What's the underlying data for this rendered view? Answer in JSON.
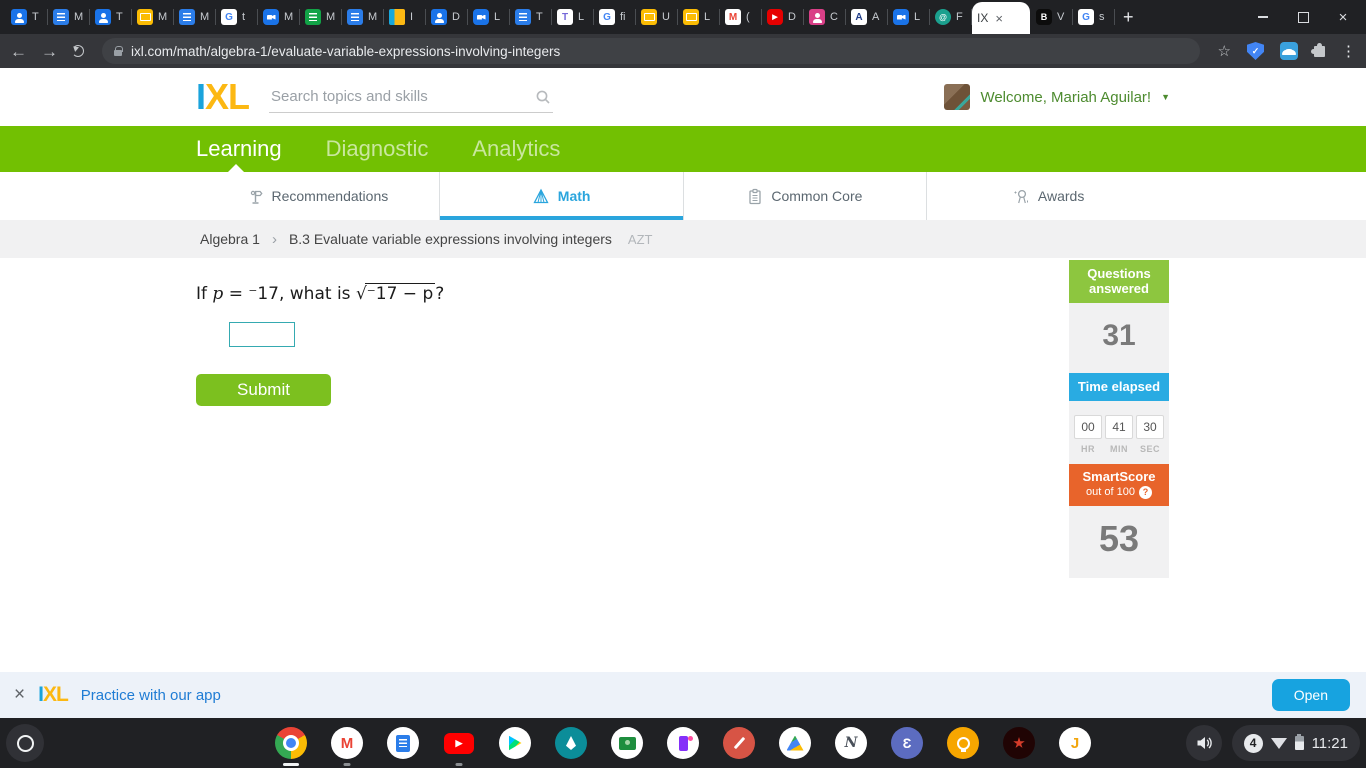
{
  "icons": {
    "back": "←",
    "forward": "→",
    "star": "☆",
    "kebab": "⋮",
    "new_tab": "+",
    "window_close": "×",
    "tab_close": "×",
    "banner_close": "×",
    "dropdown": "▼",
    "breadcrumb_sep": "›",
    "help": "?",
    "shield_check": "✓"
  },
  "browser": {
    "url": "ixl.com/math/algebra-1/evaluate-variable-expressions-involving-integers",
    "favicon_glyphs": {
      "google": "G",
      "gmail": "M",
      "youtube": "▶",
      "translate": "T",
      "acellus": "A",
      "prodigy": "@",
      "bitmoji": "B"
    },
    "tabs": [
      {
        "icon": "contacts",
        "label": "T"
      },
      {
        "icon": "docs",
        "label": "M"
      },
      {
        "icon": "contacts",
        "label": "T"
      },
      {
        "icon": "slides",
        "label": "M"
      },
      {
        "icon": "docs",
        "label": "M"
      },
      {
        "icon": "google",
        "label": "t"
      },
      {
        "icon": "meet",
        "label": "M"
      },
      {
        "icon": "sheets",
        "label": "M"
      },
      {
        "icon": "docs",
        "label": "M"
      },
      {
        "icon": "ixl",
        "label": "I"
      },
      {
        "icon": "contacts",
        "label": "D"
      },
      {
        "icon": "meet",
        "label": "L"
      },
      {
        "icon": "docs",
        "label": "T"
      },
      {
        "icon": "translate",
        "label": "L"
      },
      {
        "icon": "google",
        "label": "fi"
      },
      {
        "icon": "slides",
        "label": "U"
      },
      {
        "icon": "slides",
        "label": "L"
      },
      {
        "icon": "gmail",
        "label": "("
      },
      {
        "icon": "youtube",
        "label": "D"
      },
      {
        "icon": "contacts-pink",
        "label": "C"
      },
      {
        "icon": "acellus",
        "label": "A"
      },
      {
        "icon": "meet",
        "label": "L"
      },
      {
        "icon": "prodigy",
        "label": "F"
      },
      {
        "icon": "none",
        "label": "IX",
        "active": true
      },
      {
        "icon": "bitmoji",
        "label": "V"
      },
      {
        "icon": "google",
        "label": "s"
      }
    ]
  },
  "ixl": {
    "logo": {
      "i": "I",
      "xl": "XL"
    },
    "search_placeholder": "Search topics and skills",
    "welcome": "Welcome, Mariah Aguilar!",
    "nav": [
      {
        "label": "Learning",
        "active": true
      },
      {
        "label": "Diagnostic",
        "active": false
      },
      {
        "label": "Analytics",
        "active": false
      }
    ],
    "subnav": [
      {
        "label": "Recommendations",
        "active": false
      },
      {
        "label": "Math",
        "active": true
      },
      {
        "label": "Common Core",
        "active": false
      },
      {
        "label": "Awards",
        "active": false
      }
    ],
    "breadcrumb": {
      "category": "Algebra 1",
      "skill": "B.3 Evaluate variable expressions involving integers",
      "code": "AZT"
    },
    "question": {
      "part1": "If ",
      "variable": "p",
      "part2": " = ",
      "value": "⁻17",
      "part3": ", what is ",
      "radical": "√",
      "radicand": "⁻17 − p",
      "part4": "?",
      "answer_value": ""
    },
    "submit_label": "Submit",
    "stats": {
      "questions": {
        "title": "Questions answered",
        "value": "31"
      },
      "time": {
        "title": "Time elapsed",
        "hr": "00",
        "min": "41",
        "sec": "30",
        "hr_label": "HR",
        "min_label": "MIN",
        "sec_label": "SEC"
      },
      "smartscore": {
        "title": "SmartScore",
        "subtitle": "out of 100",
        "value": "53"
      }
    },
    "banner": {
      "logo_i": "I",
      "logo_xl": "XL",
      "text": "Practice with our app",
      "open_label": "Open"
    }
  },
  "shelf": {
    "apps": [
      {
        "name": "chrome",
        "indicator": "active"
      },
      {
        "name": "gmail",
        "indicator": "open"
      },
      {
        "name": "docs",
        "indicator": null
      },
      {
        "name": "youtube",
        "indicator": "open"
      },
      {
        "name": "play-store",
        "indicator": null
      },
      {
        "name": "painter",
        "indicator": null
      },
      {
        "name": "classroom",
        "indicator": null
      },
      {
        "name": "purple-app",
        "indicator": null
      },
      {
        "name": "sketch",
        "indicator": null
      },
      {
        "name": "drive",
        "indicator": null
      },
      {
        "name": "squid",
        "indicator": null
      },
      {
        "name": "edpuzzle",
        "indicator": null
      },
      {
        "name": "keep",
        "indicator": null
      },
      {
        "name": "game",
        "indicator": null
      },
      {
        "name": "music",
        "indicator": null
      }
    ],
    "tray": {
      "notifications": "4",
      "time": "11:21"
    }
  },
  "colors": {
    "ixl_green": "#72c002",
    "active_tab_blue": "#2aa5dd",
    "answered_green": "#8dc63f",
    "time_blue": "#29abe2",
    "smartscore_orange": "#e8642b",
    "submit_green": "#7cc01f",
    "open_blue": "#17a3e0",
    "logo_blue": "#1aa3dc",
    "logo_gold": "#fcb813"
  }
}
